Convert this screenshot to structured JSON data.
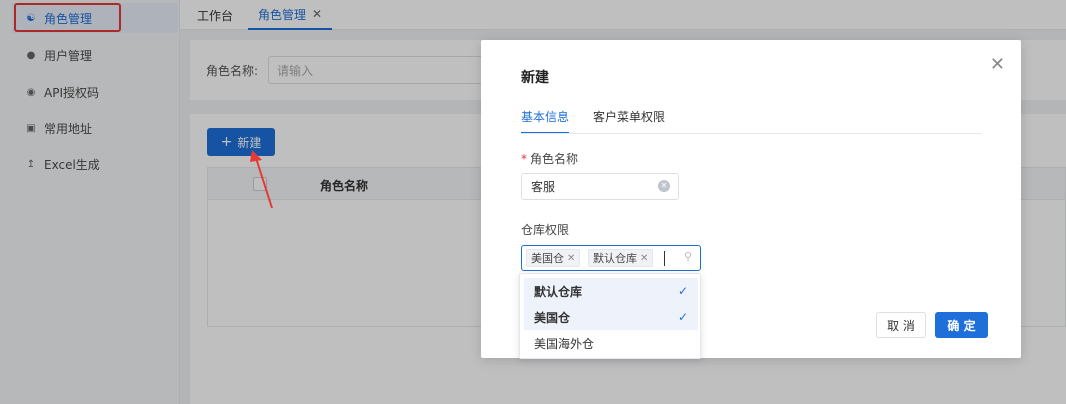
{
  "sidebar": {
    "items": [
      {
        "label": "角色管理",
        "icon": "users-icon"
      },
      {
        "label": "用户管理",
        "icon": "user-icon"
      },
      {
        "label": "API授权码",
        "icon": "eye-icon"
      },
      {
        "label": "常用地址",
        "icon": "calendar-icon"
      },
      {
        "label": "Excel生成",
        "icon": "upload-icon"
      }
    ]
  },
  "tabs": [
    {
      "label": "工作台"
    },
    {
      "label": "角色管理"
    }
  ],
  "search": {
    "label": "角色名称:",
    "placeholder": "请输入"
  },
  "toolbar": {
    "new_label": "新建"
  },
  "table": {
    "columns": [
      "角色名称"
    ]
  },
  "modal": {
    "title": "新建",
    "tabs": [
      "基本信息",
      "客户菜单权限"
    ],
    "role_name_label": "角色名称",
    "role_name_value": "客服",
    "warehouse_label": "仓库权限",
    "selected_tags": [
      "美国仓",
      "默认仓库"
    ],
    "cancel_label": "取 消",
    "ok_label": "确 定"
  },
  "dropdown": {
    "options": [
      {
        "label": "默认仓库",
        "selected": true
      },
      {
        "label": "美国仓",
        "selected": true
      },
      {
        "label": "美国海外仓",
        "selected": false
      }
    ]
  },
  "colors": {
    "primary": "#1e6fd9",
    "annotation": "#e53935"
  }
}
